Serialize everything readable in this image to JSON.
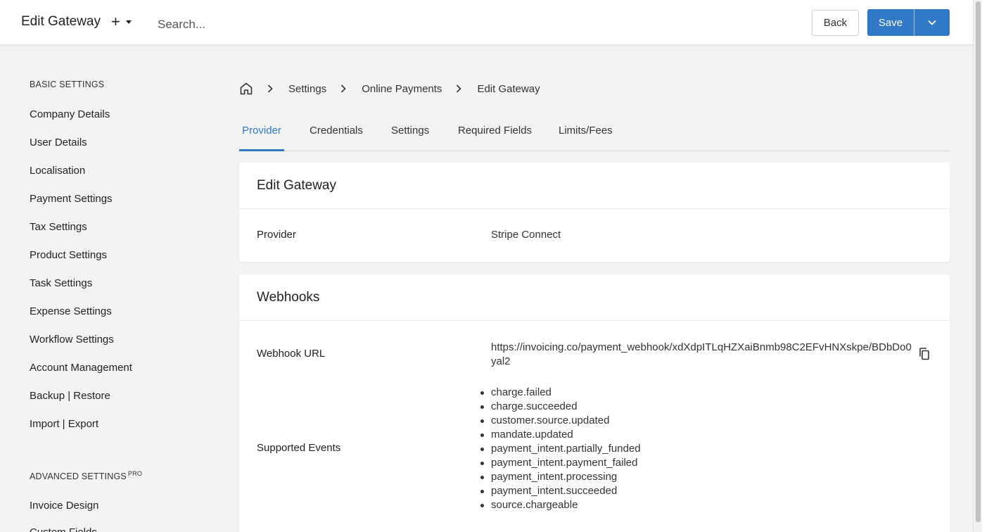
{
  "header": {
    "title": "Edit Gateway",
    "add_label": "+",
    "search_placeholder": "Search...",
    "back_label": "Back",
    "save_label": "Save"
  },
  "sidebar": {
    "basic_title": "BASIC SETTINGS",
    "basic_items": [
      "Company Details",
      "User Details",
      "Localisation",
      "Payment Settings",
      "Tax Settings",
      "Product Settings",
      "Task Settings",
      "Expense Settings",
      "Workflow Settings",
      "Account Management",
      "Backup | Restore",
      "Import | Export"
    ],
    "advanced_title": "ADVANCED SETTINGS",
    "advanced_badge": "PRO",
    "advanced_items": [
      "Invoice Design",
      "Custom Fields"
    ]
  },
  "breadcrumb": {
    "items": [
      "Settings",
      "Online Payments",
      "Edit Gateway"
    ]
  },
  "tabs": [
    "Provider",
    "Credentials",
    "Settings",
    "Required Fields",
    "Limits/Fees"
  ],
  "active_tab": "Provider",
  "gateway_card": {
    "title": "Edit Gateway",
    "provider_label": "Provider",
    "provider_value": "Stripe Connect"
  },
  "webhooks_card": {
    "title": "Webhooks",
    "url_label": "Webhook URL",
    "url_value": "https://invoicing.co/payment_webhook/xdXdpITLqHZXaiBnmb98C2EFvHNXskpe/BDbDo0yal2",
    "events_label": "Supported Events",
    "events": [
      "charge.failed",
      "charge.succeeded",
      "customer.source.updated",
      "mandate.updated",
      "payment_intent.partially_funded",
      "payment_intent.payment_failed",
      "payment_intent.processing",
      "payment_intent.succeeded",
      "source.chargeable"
    ]
  },
  "colors": {
    "accent": "#3178c6",
    "background": "#f3f3f3"
  },
  "icons": [
    "home-icon",
    "chevron-right-icon",
    "chevron-down-icon",
    "copy-icon",
    "caret-down-icon"
  ]
}
